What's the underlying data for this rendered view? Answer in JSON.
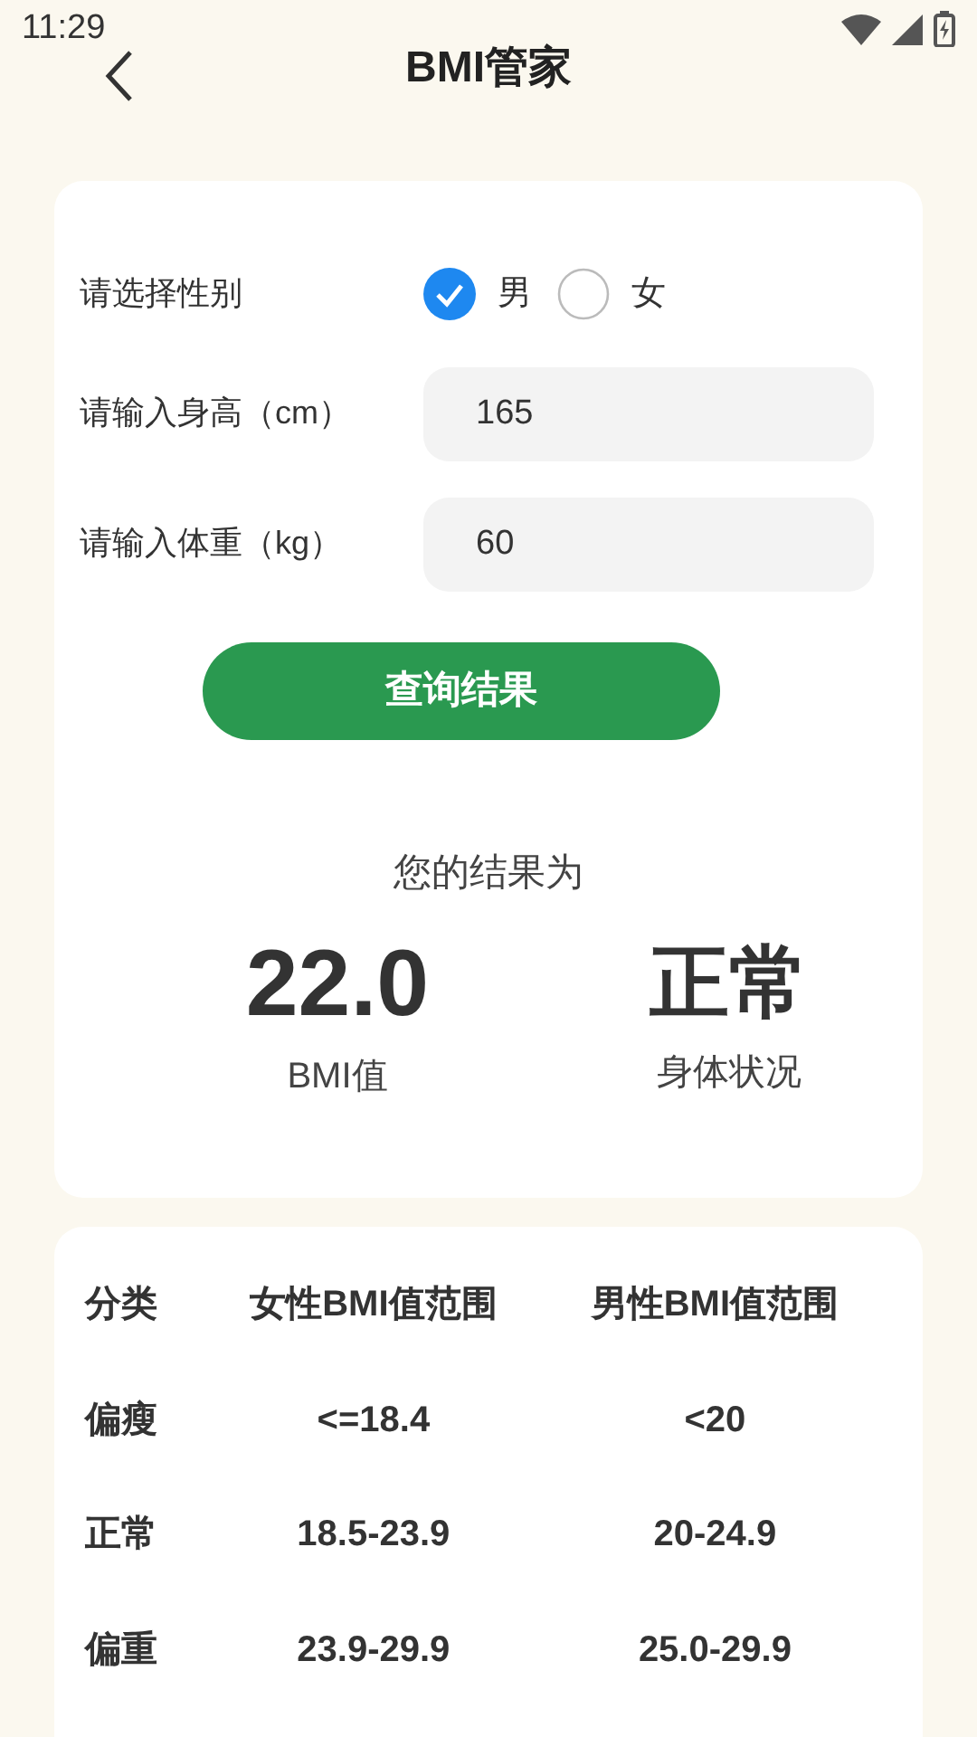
{
  "status_bar": {
    "time": "11:29"
  },
  "header": {
    "title": "BMI管家"
  },
  "form": {
    "gender_label": "请选择性别",
    "genders": [
      {
        "label": "男",
        "selected": true
      },
      {
        "label": "女",
        "selected": false
      }
    ],
    "height": {
      "label": "请输入身高（cm）",
      "value": "165"
    },
    "weight": {
      "label": "请输入体重（kg）",
      "value": "60"
    },
    "button": "查询结果"
  },
  "result": {
    "heading": "您的结果为",
    "bmi": "22.0",
    "bmi_label": "BMI值",
    "status": "正常",
    "status_label": "身体状况"
  },
  "table": {
    "columns": [
      "分类",
      "女性BMI值范围",
      "男性BMI值范围"
    ],
    "rows": [
      [
        "偏瘦",
        "<=18.4",
        "<20"
      ],
      [
        "正常",
        "18.5-23.9",
        "20-24.9"
      ],
      [
        "偏重",
        "23.9-29.9",
        "25.0-29.9"
      ]
    ]
  }
}
